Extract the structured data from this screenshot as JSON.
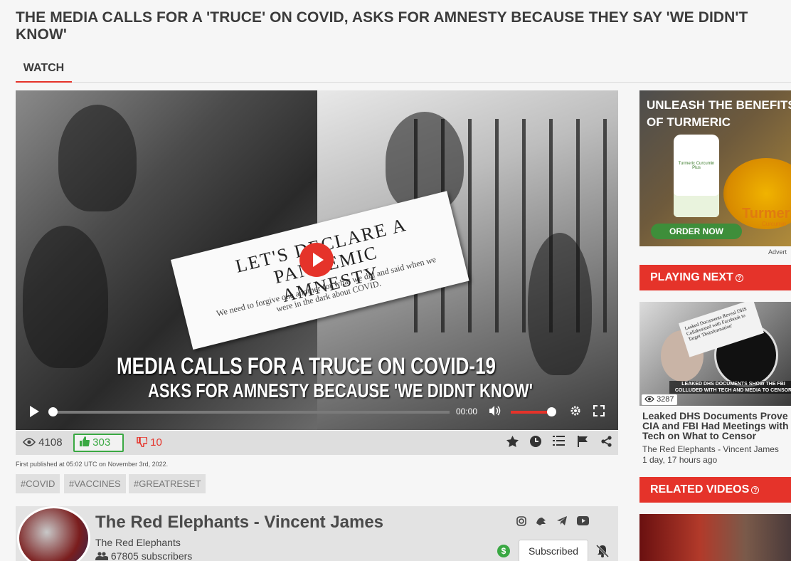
{
  "page": {
    "title": "THE MEDIA CALLS FOR A 'TRUCE' ON COVID, ASKS FOR AMNESTY BECAUSE THEY SAY 'WE DIDN'T KNOW'"
  },
  "tabs": {
    "watch": "WATCH"
  },
  "video": {
    "card_heading": "LET'S DECLARE A PANDEMIC AMNESTY",
    "card_sub": "We need to forgive one another for what we did and said when we were in the dark about COVID.",
    "caption_line1": "MEDIA CALLS FOR A TRUCE ON COVID-19",
    "caption_line2": "ASKS FOR AMNESTY BECAUSE 'WE DIDNT KNOW'",
    "time": "00:00",
    "progress": 0,
    "volume": 1.0
  },
  "stats": {
    "views": "4108",
    "likes": "303",
    "dislikes": "10"
  },
  "published": "First published at 05:02 UTC on November 3rd, 2022.",
  "tags": [
    "#COVID",
    "#VACCINES",
    "#GREATRESET"
  ],
  "channel": {
    "name": "The Red Elephants - Vincent James",
    "subtitle": "The Red Elephants",
    "subscribers": "67805 subscribers",
    "subscribe_button": "Subscribed"
  },
  "ad": {
    "headline": "UNLEASH THE BENEFITS OF TURMERIC",
    "product_label": "Turmeric Curcumin Plus",
    "brand": "Turmeric",
    "brand_sub": "Curcumin",
    "cta": "ORDER NOW",
    "advert_label": "Advert"
  },
  "sidebar": {
    "playing_next_heading": "PLAYING NEXT",
    "next_video": {
      "views": "3287",
      "title": "Leaked DHS Documents Prove CIA and FBI Had Meetings with Tech on What to Censor",
      "channel": "The Red Elephants - Vincent James",
      "age": "1 day, 17 hours ago",
      "thumb_doc": "Leaked Documents Reveal DHS Collaborated with Facebook to Target 'Disinformation'",
      "thumb_caption": "LEAKED DHS DOCUMENTS SHOW THE FBI COLLUDED WITH TECH AND MEDIA TO CENSOR"
    },
    "related_heading": "RELATED VIDEOS"
  },
  "colors": {
    "accent": "#e5332a",
    "like": "#3aa843"
  },
  "icons": [
    "eye-icon",
    "thumbs-up-icon",
    "thumbs-down-icon",
    "star-icon",
    "clock-icon",
    "list-icon",
    "flag-icon",
    "share-icon",
    "play-icon",
    "volume-icon",
    "settings-icon",
    "fullscreen-icon",
    "instagram-icon",
    "gab-icon",
    "telegram-icon",
    "youtube-icon",
    "dollar-icon",
    "bell-off-icon",
    "users-icon",
    "help-icon"
  ]
}
